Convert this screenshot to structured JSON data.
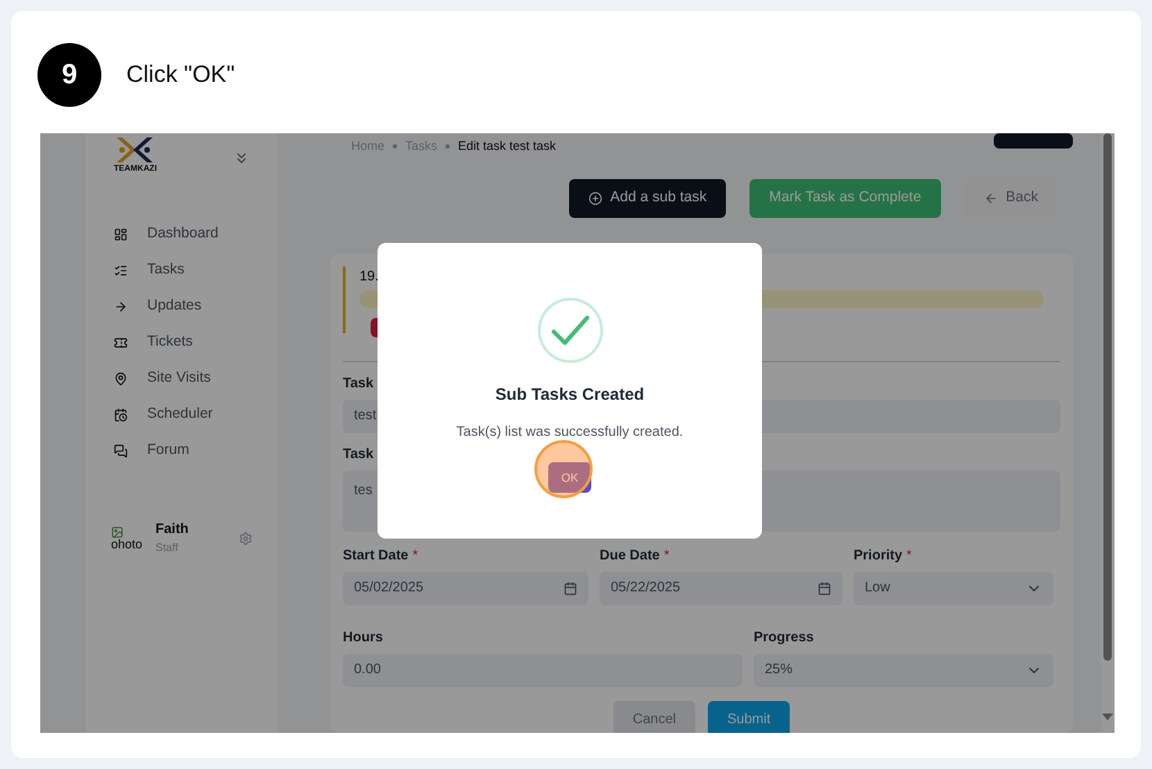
{
  "step": {
    "number": "9",
    "instruction": "Click \"OK\""
  },
  "sidebar": {
    "logo_text": "TEAMKAZI",
    "items": [
      {
        "label": "Dashboard"
      },
      {
        "label": "Tasks"
      },
      {
        "label": "Updates"
      },
      {
        "label": "Tickets"
      },
      {
        "label": "Site Visits"
      },
      {
        "label": "Scheduler"
      },
      {
        "label": "Forum"
      }
    ],
    "user": {
      "avatar_alt": "ohoto",
      "name": "Faith",
      "role": "Staff"
    }
  },
  "breadcrumb": [
    "Home",
    "Tasks",
    "Edit task test task"
  ],
  "actions": [
    {
      "label": "Add a sub task",
      "kind": "dark"
    },
    {
      "label": "Mark Task as Complete",
      "kind": "success"
    },
    {
      "label": "Back",
      "kind": "ghost"
    }
  ],
  "task_card": {
    "number": "19."
  },
  "form": {
    "rows": [
      [
        {
          "label": "Task",
          "kind": "text",
          "value": "test"
        }
      ],
      [
        {
          "label": "Task",
          "kind": "textarea",
          "value": "tes"
        }
      ],
      [
        {
          "label": "Start Date",
          "required_mark": "*",
          "kind": "date",
          "value": "05/02/2025"
        },
        {
          "label": "Due Date",
          "required_mark": "*",
          "kind": "date",
          "value": "05/22/2025"
        },
        {
          "label": "Priority",
          "required_mark": "*",
          "kind": "select",
          "value": "Low"
        }
      ],
      [
        {
          "label": "Hours",
          "kind": "text",
          "value": "0.00"
        },
        {
          "label": "Progress",
          "kind": "select",
          "value": "25%"
        }
      ]
    ],
    "buttons": [
      {
        "label": "Cancel",
        "kind": "secondary"
      },
      {
        "label": "Submit",
        "kind": "primary"
      }
    ]
  },
  "dialog": {
    "title": "Sub Tasks Created",
    "message": "Task(s) list was successfully created.",
    "button": "OK"
  }
}
